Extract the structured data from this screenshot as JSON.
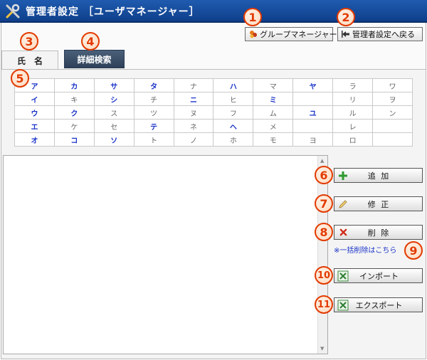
{
  "window": {
    "title": "管理者設定 ［ユーザマネージャー］"
  },
  "toolbar": {
    "group_manager_label": "グループマネージャー",
    "back_label": "管理者設定へ戻る"
  },
  "tabs": [
    {
      "label": "氏　名"
    },
    {
      "label": "詳細検索"
    }
  ],
  "kana_rows": [
    [
      "ア",
      "カ",
      "サ",
      "タ",
      "ナ",
      "ハ",
      "マ",
      "ヤ",
      "ラ",
      "ワ"
    ],
    [
      "イ",
      "キ",
      "シ",
      "チ",
      "ニ",
      "ヒ",
      "ミ",
      "",
      "リ",
      "ヲ"
    ],
    [
      "ウ",
      "ク",
      "ス",
      "ツ",
      "ヌ",
      "フ",
      "ム",
      "ユ",
      "ル",
      "ン"
    ],
    [
      "エ",
      "ケ",
      "セ",
      "テ",
      "ネ",
      "ヘ",
      "メ",
      "",
      "レ",
      ""
    ],
    [
      "オ",
      "コ",
      "ソ",
      "ト",
      "ノ",
      "ホ",
      "モ",
      "ヨ",
      "ロ",
      ""
    ]
  ],
  "kana_active": [
    [
      true,
      true,
      true,
      true,
      false,
      true,
      false,
      true,
      false,
      false
    ],
    [
      true,
      false,
      true,
      false,
      true,
      false,
      true,
      false,
      false,
      false
    ],
    [
      true,
      true,
      false,
      false,
      false,
      false,
      false,
      true,
      false,
      false
    ],
    [
      true,
      false,
      false,
      true,
      false,
      true,
      false,
      false,
      false,
      false
    ],
    [
      true,
      true,
      true,
      false,
      false,
      false,
      false,
      false,
      false,
      false
    ]
  ],
  "actions": {
    "add_label": "追 加",
    "edit_label": "修 正",
    "delete_label": "削 除",
    "bulk_delete_link": "※一括削除はこちら",
    "import_label": "インポート",
    "export_label": "エクスポート"
  },
  "callouts": [
    "1",
    "2",
    "3",
    "4",
    "5",
    "6",
    "7",
    "8",
    "9",
    "10",
    "11"
  ],
  "colors": {
    "titlebar": "#1f5bb0",
    "tab_active": "#2f4159",
    "kana_link": "#1a33c9",
    "callout": "#e23a00"
  }
}
